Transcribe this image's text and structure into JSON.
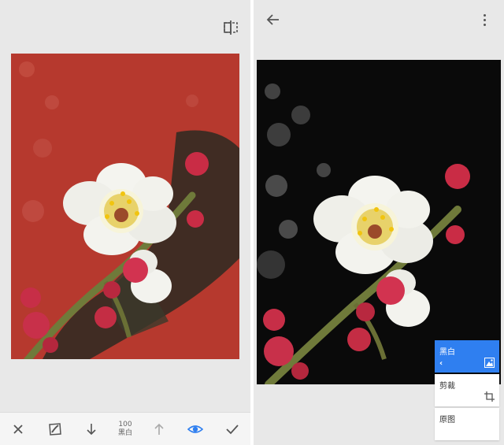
{
  "colors": {
    "accent": "#2f7ff0",
    "left_background": "#b6392e",
    "right_background": "#0a0a0a",
    "screen_bg": "#e8e8e8"
  },
  "left_screen": {
    "compare_icon": "compare-split-icon",
    "toolbar": {
      "cancel_icon": "close-icon",
      "brush_icon": "brush-icon",
      "decrease_icon": "arrow-down-icon",
      "param_value": "100",
      "param_name": "黑白",
      "increase_icon": "arrow-up-icon",
      "view_icon": "eye-icon",
      "apply_icon": "check-icon"
    }
  },
  "right_screen": {
    "back_icon": "arrow-left-icon",
    "more_icon": "more-vert-icon",
    "menu": [
      {
        "label": "黑白",
        "chevron": "‹",
        "icon": "black-white-icon",
        "active": true
      },
      {
        "label": "剪裁",
        "icon": "crop-icon",
        "active": false
      },
      {
        "label": "原图",
        "active": false
      }
    ]
  }
}
